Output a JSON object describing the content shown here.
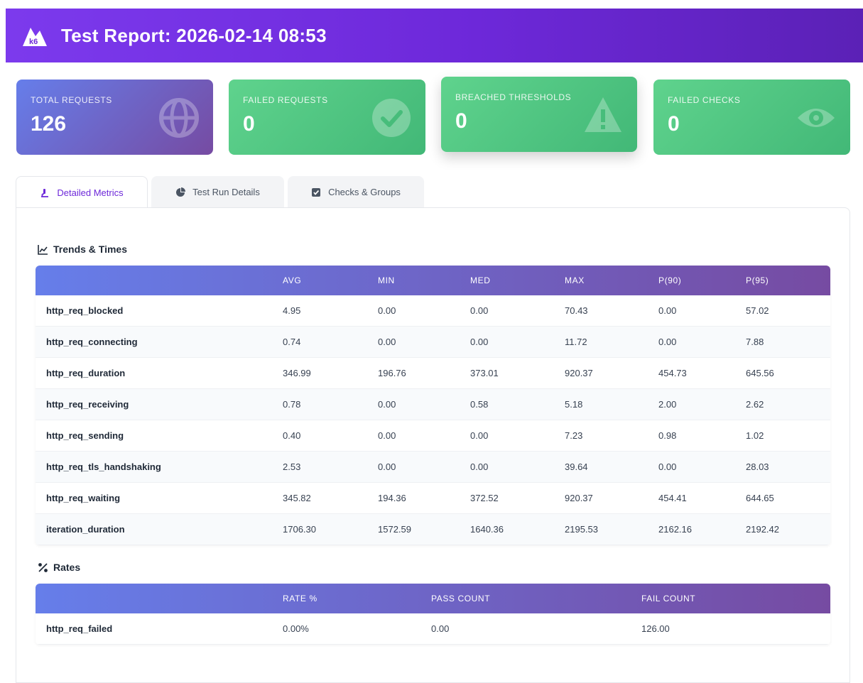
{
  "header": {
    "title": "Test Report: 2026-02-14 08:53",
    "logo_text": "k6",
    "color": "#7c3aed"
  },
  "cards": [
    {
      "label": "TOTAL REQUESTS",
      "value": "126",
      "icon": "globe-icon"
    },
    {
      "label": "FAILED REQUESTS",
      "value": "0",
      "icon": "check-circle-icon"
    },
    {
      "label": "BREACHED THRESHOLDS",
      "value": "0",
      "icon": "warning-icon"
    },
    {
      "label": "FAILED CHECKS",
      "value": "0",
      "icon": "eye-icon"
    }
  ],
  "tabs": [
    {
      "label": "Detailed Metrics",
      "icon": "microscope-icon",
      "active": true
    },
    {
      "label": "Test Run Details",
      "icon": "pie-chart-icon",
      "active": false
    },
    {
      "label": "Checks & Groups",
      "icon": "checkbox-icon",
      "active": false
    }
  ],
  "trends": {
    "title": "Trends & Times",
    "icon": "line-chart-icon",
    "columns": [
      "AVG",
      "MIN",
      "MED",
      "MAX",
      "P(90)",
      "P(95)"
    ],
    "rows": [
      {
        "name": "http_req_blocked",
        "values": [
          "4.95",
          "0.00",
          "0.00",
          "70.43",
          "0.00",
          "57.02"
        ]
      },
      {
        "name": "http_req_connecting",
        "values": [
          "0.74",
          "0.00",
          "0.00",
          "11.72",
          "0.00",
          "7.88"
        ]
      },
      {
        "name": "http_req_duration",
        "values": [
          "346.99",
          "196.76",
          "373.01",
          "920.37",
          "454.73",
          "645.56"
        ]
      },
      {
        "name": "http_req_receiving",
        "values": [
          "0.78",
          "0.00",
          "0.58",
          "5.18",
          "2.00",
          "2.62"
        ]
      },
      {
        "name": "http_req_sending",
        "values": [
          "0.40",
          "0.00",
          "0.00",
          "7.23",
          "0.98",
          "1.02"
        ]
      },
      {
        "name": "http_req_tls_handshaking",
        "values": [
          "2.53",
          "0.00",
          "0.00",
          "39.64",
          "0.00",
          "28.03"
        ]
      },
      {
        "name": "http_req_waiting",
        "values": [
          "345.82",
          "194.36",
          "372.52",
          "920.37",
          "454.41",
          "644.65"
        ]
      },
      {
        "name": "iteration_duration",
        "values": [
          "1706.30",
          "1572.59",
          "1640.36",
          "2195.53",
          "2162.16",
          "2192.42"
        ]
      }
    ]
  },
  "rates": {
    "title": "Rates",
    "icon": "percent-icon",
    "columns": [
      "RATE %",
      "PASS COUNT",
      "FAIL COUNT"
    ],
    "rows": [
      {
        "name": "http_req_failed",
        "values": [
          "0.00%",
          "0.00",
          "126.00"
        ]
      }
    ]
  }
}
